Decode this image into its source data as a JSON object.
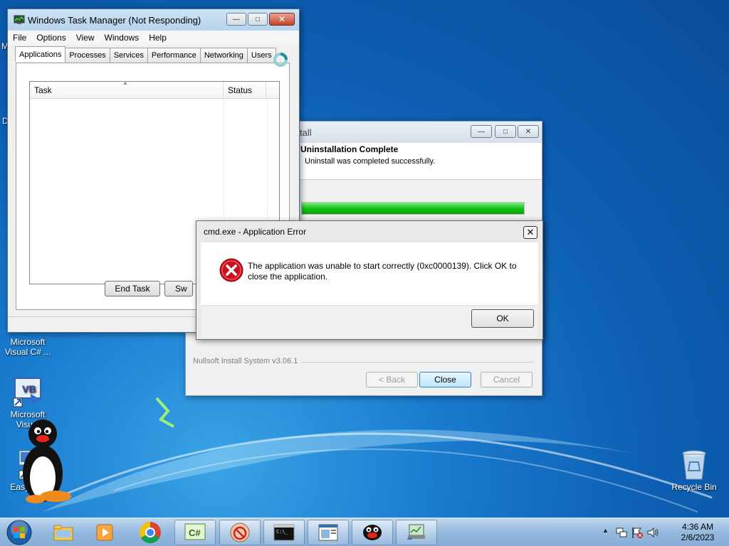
{
  "desktop": {
    "edge_letters": [
      "M",
      "D"
    ],
    "icons": [
      {
        "line1": "Microsoft",
        "line2": "Visual C# ..."
      },
      {
        "line1": "Microsoft",
        "line2": "Visual"
      },
      {
        "line1": "EasyL",
        "line2": ""
      },
      {
        "line1": "Recycle Bin",
        "line2": ""
      }
    ]
  },
  "task_manager": {
    "title": "Windows Task Manager (Not Responding)",
    "menu": [
      "File",
      "Options",
      "View",
      "Windows",
      "Help"
    ],
    "tabs": [
      "Applications",
      "Processes",
      "Services",
      "Performance",
      "Networking",
      "Users"
    ],
    "columns": [
      "Task",
      "Status"
    ],
    "end_task_label": "End Task",
    "switch_to_label": "Sw"
  },
  "installer": {
    "title_fragment": "tall",
    "header_title": "Uninstallation Complete",
    "header_subtitle": "Uninstall was completed successfully.",
    "progress_fraction": 1.0,
    "branding": "Nullsoft Install System v3.06.1",
    "back_label": "< Back",
    "close_label": "Close",
    "cancel_label": "Cancel"
  },
  "error_dialog": {
    "title": "cmd.exe - Application Error",
    "message_line1": "The application was unable to start correctly (0xc0000139). Click OK to",
    "message_line2": "close the application.",
    "ok_label": "OK",
    "icon": "error-icon"
  },
  "taskbar": {
    "time": "4:36 AM",
    "date": "2/6/2023",
    "items": [
      "start-orb",
      "file-explorer",
      "media-player",
      "chrome",
      "csharp-project",
      "installer-app",
      "command-prompt",
      "task-manager",
      "pingu",
      "network-app"
    ]
  },
  "colors": {
    "progress_green": "#13c413",
    "error_red": "#c8101e",
    "desktop_blue": "#0d5fb3"
  }
}
